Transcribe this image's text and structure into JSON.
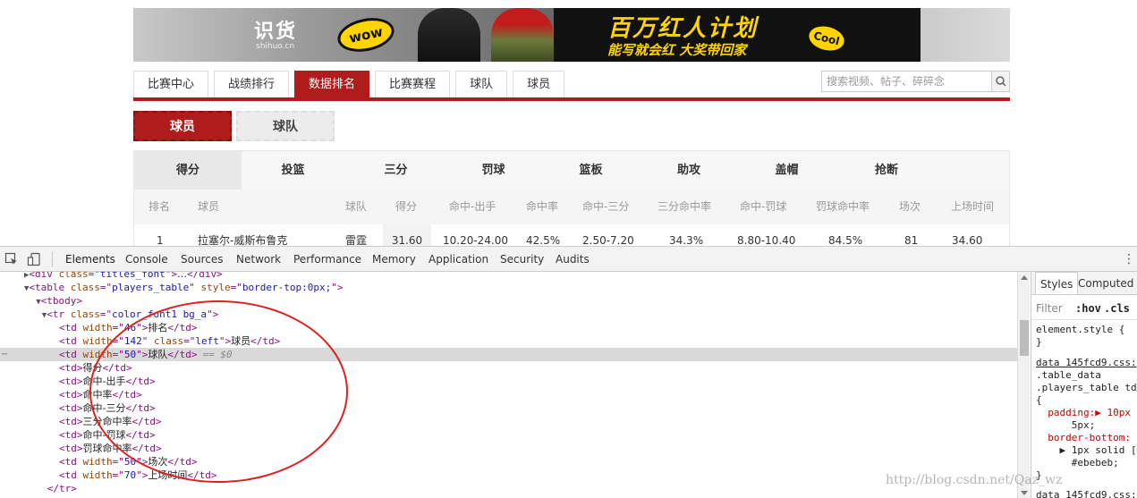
{
  "banner": {
    "logo_text": "识货",
    "logo_sub": "shihuo.cn",
    "badge_left": "wow",
    "promo_title": "百万红人计划",
    "promo_subtitle": "能写就会红 大奖带回家",
    "badge_right": "Cool"
  },
  "nav": {
    "tabs": [
      "比赛中心",
      "战绩排行",
      "数据排名",
      "比赛赛程",
      "球队",
      "球员"
    ],
    "active_index": 2
  },
  "search": {
    "placeholder": "搜索视频、帖子、碎碎念"
  },
  "subtabs": {
    "active": "球员",
    "inactive": "球队"
  },
  "stats": {
    "categories": [
      "得分",
      "投篮",
      "三分",
      "罚球",
      "篮板",
      "助攻",
      "盖帽",
      "抢断"
    ],
    "headers": [
      "排名",
      "球员",
      "球队",
      "得分",
      "命中-出手",
      "命中率",
      "命中-三分",
      "三分命中率",
      "命中-罚球",
      "罚球命中率",
      "场次",
      "上场时间"
    ],
    "first_row": [
      "1",
      "拉塞尔-威斯布鲁克",
      "雷霆",
      "31.60",
      "10.20-24.00",
      "42.5%",
      "2.50-7.20",
      "34.3%",
      "8.80-10.40",
      "84.5%",
      "81",
      "34.60"
    ]
  },
  "devtools": {
    "tabs": [
      "Elements",
      "Console",
      "Sources",
      "Network",
      "Performance",
      "Memory",
      "Application",
      "Security",
      "Audits"
    ],
    "active_tab": "Elements",
    "styles_tabs": [
      "Styles",
      "Computed"
    ],
    "filter_placeholder": "Filter",
    "hov": ":hov",
    "cls": ".cls",
    "selected_marker": "== $0",
    "dom_lines": [
      {
        "indent": 5,
        "tri": "▶",
        "parts": [
          [
            "tag",
            "<div "
          ],
          [
            "attr",
            "class"
          ],
          [
            "tag",
            "=\""
          ],
          [
            "val",
            "titles_font"
          ],
          [
            "tag",
            "\">"
          ],
          [
            "txt",
            "…"
          ],
          [
            "tag",
            "</div>"
          ]
        ]
      },
      {
        "indent": 5,
        "tri": "▼",
        "parts": [
          [
            "tag",
            "<table "
          ],
          [
            "attr",
            "class"
          ],
          [
            "tag",
            "=\""
          ],
          [
            "val",
            "players_table"
          ],
          [
            "tag",
            "\" "
          ],
          [
            "attr",
            "style"
          ],
          [
            "tag",
            "=\""
          ],
          [
            "val",
            "border-top:0px;"
          ],
          [
            "tag",
            "\">"
          ]
        ]
      },
      {
        "indent": 7,
        "tri": "▼",
        "parts": [
          [
            "tag",
            "<tbody>"
          ]
        ]
      },
      {
        "indent": 8,
        "tri": "▼",
        "parts": [
          [
            "tag",
            "<tr "
          ],
          [
            "attr",
            "class"
          ],
          [
            "tag",
            "=\""
          ],
          [
            "val",
            "color_font1 bg_a"
          ],
          [
            "tag",
            "\">"
          ]
        ]
      },
      {
        "indent": 10,
        "tri": "",
        "parts": [
          [
            "tag",
            "<td "
          ],
          [
            "attr",
            "width"
          ],
          [
            "tag",
            "=\""
          ],
          [
            "val",
            "46"
          ],
          [
            "tag",
            "\">"
          ],
          [
            "txt",
            "排名"
          ],
          [
            "tag",
            "</td>"
          ]
        ]
      },
      {
        "indent": 10,
        "tri": "",
        "parts": [
          [
            "tag",
            "<td "
          ],
          [
            "attr",
            "width"
          ],
          [
            "tag",
            "=\""
          ],
          [
            "val",
            "142"
          ],
          [
            "tag",
            "\" "
          ],
          [
            "attr",
            "class"
          ],
          [
            "tag",
            "=\""
          ],
          [
            "val",
            "left"
          ],
          [
            "tag",
            "\">"
          ],
          [
            "txt",
            "球员"
          ],
          [
            "tag",
            "</td>"
          ]
        ]
      },
      {
        "indent": 10,
        "tri": "",
        "selected": true,
        "parts": [
          [
            "tag",
            "<td "
          ],
          [
            "attr",
            "width"
          ],
          [
            "tag",
            "=\""
          ],
          [
            "val",
            "50"
          ],
          [
            "tag",
            "\">"
          ],
          [
            "txt",
            "球队"
          ],
          [
            "tag",
            "</td>"
          ]
        ]
      },
      {
        "indent": 10,
        "tri": "",
        "parts": [
          [
            "tag",
            "<td>"
          ],
          [
            "txt",
            "得分"
          ],
          [
            "tag",
            "</td>"
          ]
        ]
      },
      {
        "indent": 10,
        "tri": "",
        "parts": [
          [
            "tag",
            "<td>"
          ],
          [
            "txt",
            "命中-出手"
          ],
          [
            "tag",
            "</td>"
          ]
        ]
      },
      {
        "indent": 10,
        "tri": "",
        "parts": [
          [
            "tag",
            "<td>"
          ],
          [
            "txt",
            "命中率"
          ],
          [
            "tag",
            "</td>"
          ]
        ]
      },
      {
        "indent": 10,
        "tri": "",
        "parts": [
          [
            "tag",
            "<td>"
          ],
          [
            "txt",
            "命中-三分"
          ],
          [
            "tag",
            "</td>"
          ]
        ]
      },
      {
        "indent": 10,
        "tri": "",
        "parts": [
          [
            "tag",
            "<td>"
          ],
          [
            "txt",
            "三分命中率"
          ],
          [
            "tag",
            "</td>"
          ]
        ]
      },
      {
        "indent": 10,
        "tri": "",
        "parts": [
          [
            "tag",
            "<td>"
          ],
          [
            "txt",
            "命中-罚球"
          ],
          [
            "tag",
            "</td>"
          ]
        ]
      },
      {
        "indent": 10,
        "tri": "",
        "parts": [
          [
            "tag",
            "<td>"
          ],
          [
            "txt",
            "罚球命中率"
          ],
          [
            "tag",
            "</td>"
          ]
        ]
      },
      {
        "indent": 10,
        "tri": "",
        "parts": [
          [
            "tag",
            "<td "
          ],
          [
            "attr",
            "width"
          ],
          [
            "tag",
            "=\""
          ],
          [
            "val",
            "50"
          ],
          [
            "tag",
            "\">"
          ],
          [
            "txt",
            "场次"
          ],
          [
            "tag",
            "</td>"
          ]
        ]
      },
      {
        "indent": 10,
        "tri": "",
        "parts": [
          [
            "tag",
            "<td "
          ],
          [
            "attr",
            "width"
          ],
          [
            "tag",
            "=\""
          ],
          [
            "val",
            "70"
          ],
          [
            "tag",
            "\">"
          ],
          [
            "txt",
            "上场时间"
          ],
          [
            "tag",
            "</td>"
          ]
        ]
      },
      {
        "indent": 8,
        "tri": "",
        "parts": [
          [
            "tag",
            "</tr>"
          ]
        ]
      }
    ],
    "styles_lines": [
      {
        "cls": "s-sel",
        "text": "element.style {"
      },
      {
        "cls": "s-sel",
        "text": "}"
      },
      {
        "cls": "s-link",
        "text": "data 145fcd9.css:"
      },
      {
        "cls": "s-sel",
        "text": ".table_data"
      },
      {
        "cls": "s-sel",
        "text": ".players_table td"
      },
      {
        "cls": "s-sel",
        "text": "{"
      },
      {
        "cls": "s-prop",
        "text": "  padding:▶ 10px"
      },
      {
        "cls": "s-sel",
        "text": "      5px;"
      },
      {
        "cls": "s-prop",
        "text": "  border-bottom:"
      },
      {
        "cls": "s-sel",
        "text": "    ▶ 1px solid ["
      },
      {
        "cls": "s-sel",
        "text": "      #ebebeb;"
      },
      {
        "cls": "s-sel",
        "text": "}"
      },
      {
        "cls": "s-link",
        "text": "data 145fcd9.css:"
      }
    ]
  },
  "watermark": "http://blog.csdn.net/Qaz_wz",
  "colors": {
    "accent": "#b01b1b",
    "circle": "#e02020"
  }
}
